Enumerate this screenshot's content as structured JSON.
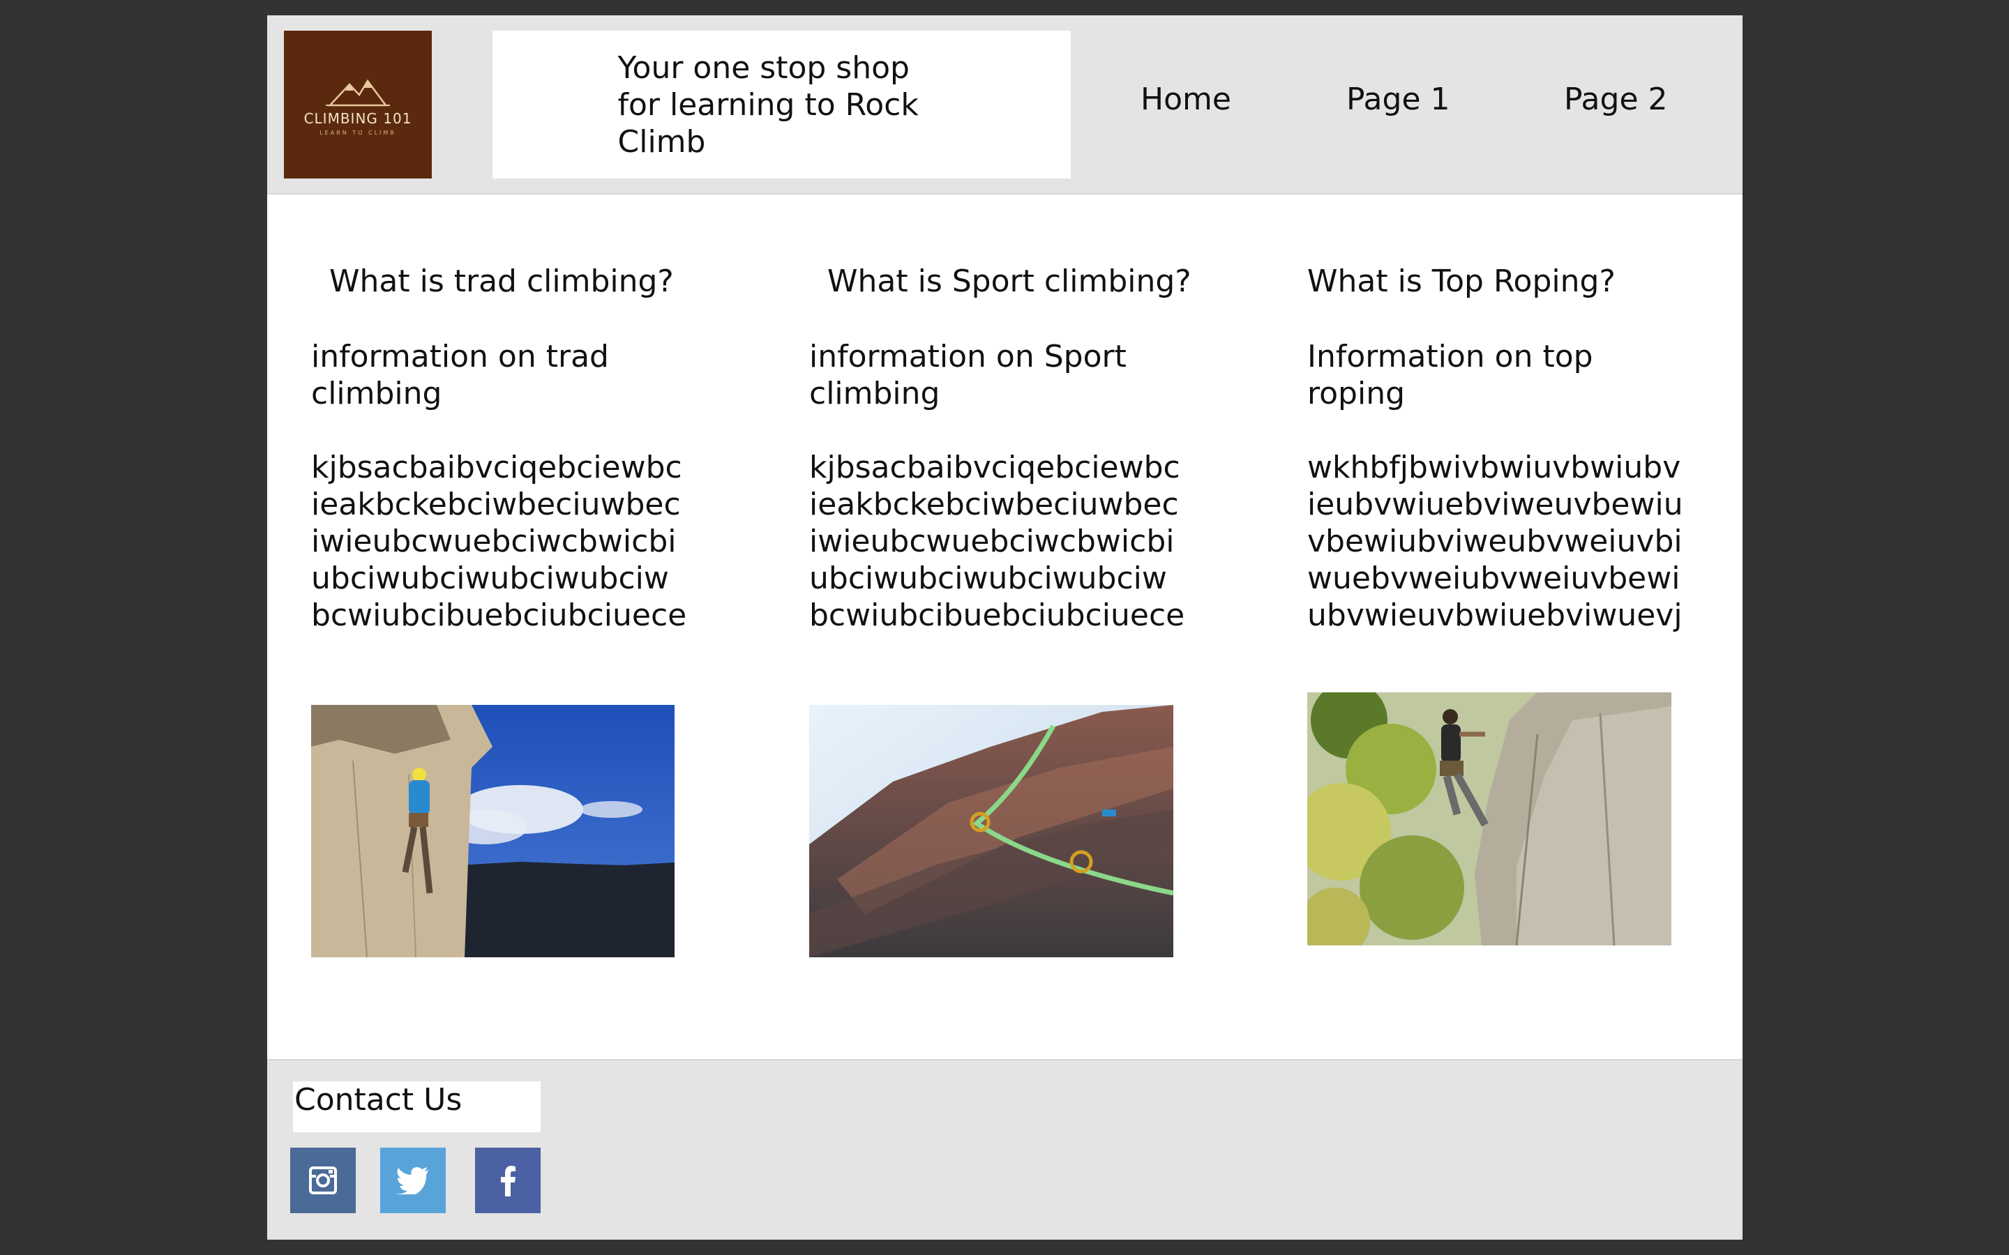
{
  "header": {
    "logo": {
      "title": "CLIMBING 101",
      "subtitle": "LEARN TO CLIMB"
    },
    "tagline": "Your one stop shop for learning to Rock Climb",
    "nav": [
      "Home",
      "Page 1",
      "Page 2"
    ]
  },
  "columns": [
    {
      "heading": "What is trad climbing?",
      "info": "information on trad climbing",
      "body": "kjbsacbaibvciqebciewbcieakbckebciwbeciuwbeciwieubcwuebciwcbwicbiubciwubciwubciwubciwbcwiubcibuebciubciuece",
      "image": "trad-climber-photo"
    },
    {
      "heading": "What is Sport climbing?",
      "info": "information on Sport climbing",
      "body": "kjbsacbaibvciqebciewbcieakbckebciwbeciuwbeciwieubcwuebciwcbwicbiubciwubciwubciwubciwbcwiubcibuebciubciuece",
      "image": "sport-rope-photo"
    },
    {
      "heading": "What is Top Roping?",
      "info": "Information on top roping",
      "body": "wkhbfjbwivbwiuvbwiubvieubvwiuebviweuvbewiuvbewiubviweubvweiuvbiwuebvweiubvweiuvbewiubvwieuvbwiuebviwuevj",
      "image": "top-rope-climber-photo"
    }
  ],
  "footer": {
    "contact_label": "Contact Us",
    "social": [
      "instagram-icon",
      "twitter-icon",
      "facebook-icon"
    ],
    "colors": {
      "instagram": "#4a6b97",
      "twitter": "#58a4da",
      "facebook": "#4b61a3"
    }
  },
  "colors": {
    "header_bg": "#e4e4e4",
    "logo_bg": "#5b2a0e",
    "page_bg": "#333333"
  }
}
